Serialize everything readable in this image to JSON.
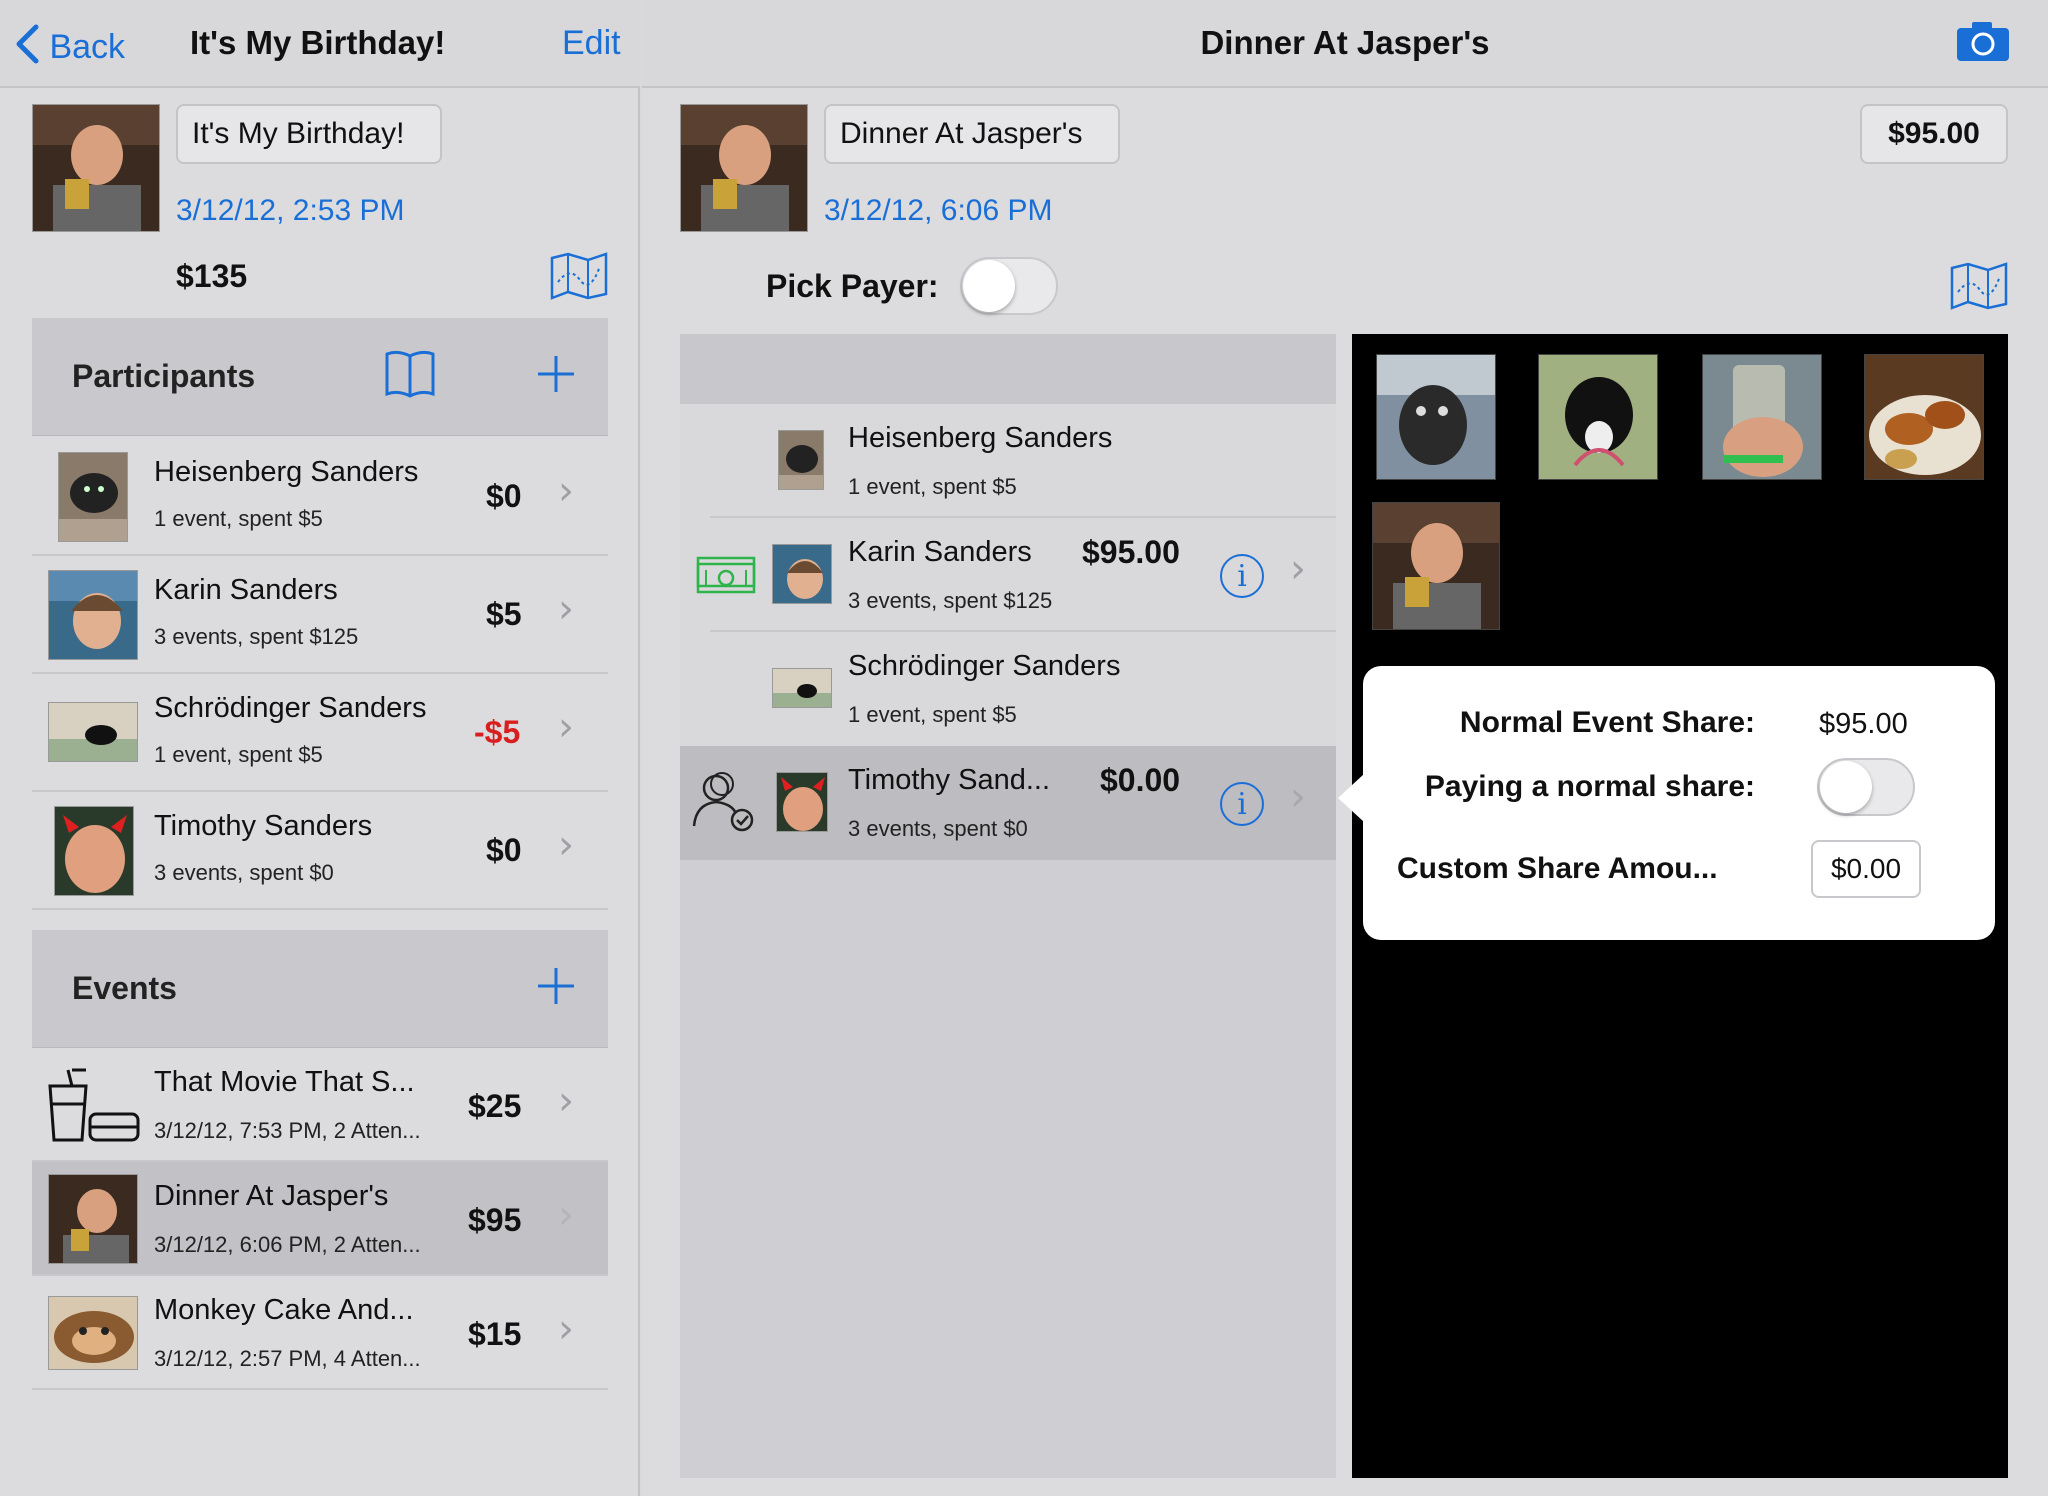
{
  "colors": {
    "accent": "#1a6fd6",
    "payer_green": "#2fb44c",
    "negative_red": "#d81e1e"
  },
  "left": {
    "nav": {
      "back_label": "Back",
      "title": "It's My Birthday!",
      "edit_label": "Edit"
    },
    "group": {
      "name_value": "It's My Birthday!",
      "date": "3/12/12, 2:53 PM",
      "total": "$135"
    },
    "participants_header": "Participants",
    "participants": [
      {
        "name": "Heisenberg Sanders",
        "sub": "1 event, spent $5",
        "amount": "$0"
      },
      {
        "name": "Karin Sanders",
        "sub": "3 events, spent $125",
        "amount": "$5"
      },
      {
        "name": "Schrödinger Sanders",
        "sub": "1 event, spent $5",
        "amount": "-$5"
      },
      {
        "name": "Timothy Sanders",
        "sub": "3 events, spent $0",
        "amount": "$0"
      }
    ],
    "events_header": "Events",
    "events": [
      {
        "name": "That Movie That S...",
        "sub": "3/12/12, 7:53 PM, 2 Atten...",
        "amount": "$25"
      },
      {
        "name": "Dinner At Jasper's",
        "sub": "3/12/12, 6:06 PM, 2 Atten...",
        "amount": "$95"
      },
      {
        "name": "Monkey Cake And...",
        "sub": "3/12/12, 2:57 PM, 4 Atten...",
        "amount": "$15"
      }
    ]
  },
  "right": {
    "nav": {
      "title": "Dinner At Jasper's"
    },
    "event": {
      "name_value": "Dinner At Jasper's",
      "date": "3/12/12, 6:06 PM",
      "amount_value": "$95.00"
    },
    "pick_payer_label": "Pick Payer:",
    "attendees": [
      {
        "name": "Heisenberg Sanders",
        "sub": "1 event, spent $5",
        "amount": ""
      },
      {
        "name": "Karin Sanders",
        "sub": "3 events, spent $125",
        "amount": "$95.00"
      },
      {
        "name": "Schrödinger Sanders",
        "sub": "1 event, spent $5",
        "amount": ""
      },
      {
        "name": "Timothy Sand...",
        "sub": "3 events, spent $0",
        "amount": "$0.00"
      }
    ],
    "popover": {
      "normal_share_label": "Normal Event Share:",
      "normal_share_value": "$95.00",
      "paying_normal_label": "Paying a normal share:",
      "custom_share_label": "Custom Share Amou...",
      "custom_share_value": "$0.00"
    }
  }
}
